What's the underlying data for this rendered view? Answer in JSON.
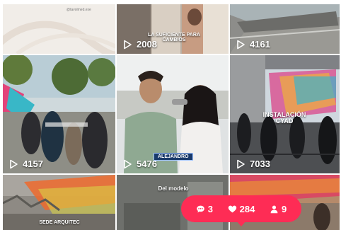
{
  "grid": {
    "tiles": [
      {
        "id": "t1",
        "views": "",
        "caption": "",
        "handle": "@tavolmed.exe"
      },
      {
        "id": "t2",
        "views": "2008",
        "caption": "LA SUFICIENTE PARA CAMBIOS"
      },
      {
        "id": "t3",
        "views": "4161",
        "caption": ""
      },
      {
        "id": "t4",
        "views": "4157",
        "caption": ""
      },
      {
        "id": "t5",
        "views": "5476",
        "caption": "",
        "name_tag": "ALEJANDRO"
      },
      {
        "id": "t6",
        "views": "7033",
        "caption": "INSTALACIÓN CYAD"
      },
      {
        "id": "t7",
        "views": "",
        "caption": "SEDE ARQUITEC"
      },
      {
        "id": "t8",
        "views": "",
        "caption": "Del modelo"
      },
      {
        "id": "t9",
        "views": "",
        "caption": ""
      }
    ]
  },
  "stats_badge": {
    "comments": "3",
    "likes": "284",
    "followers": "9",
    "color": "#fe2c55"
  }
}
